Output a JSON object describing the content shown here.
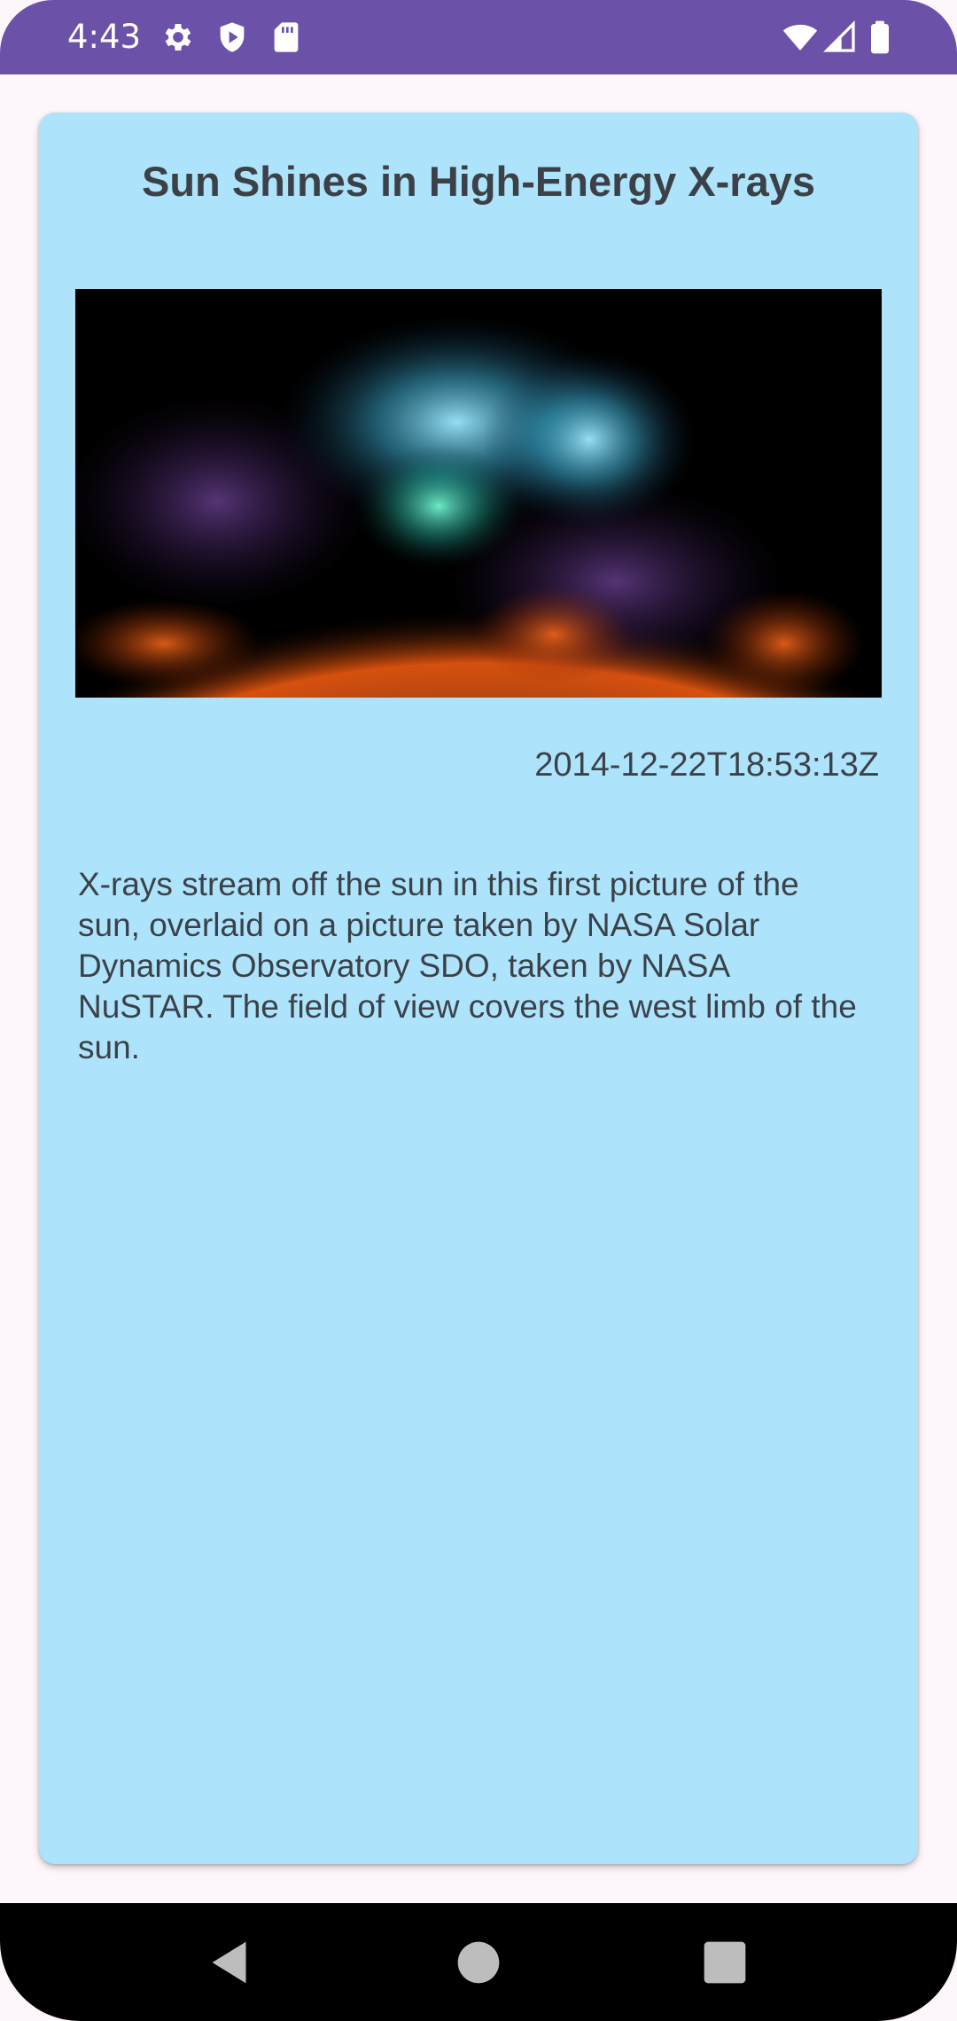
{
  "status_bar": {
    "time": "4:43",
    "left_icons": [
      "gear-icon",
      "shield-play-icon",
      "sd-card-icon"
    ],
    "right_icons": [
      "wifi-icon",
      "cell-signal-icon",
      "battery-icon"
    ],
    "color": "#6b52a8"
  },
  "card": {
    "title": "Sun Shines in High-Energy X-rays",
    "image_alt": "X-ray image of the sun",
    "date": "2014-12-22T18:53:13Z",
    "description": "X-rays stream off the sun in this first picture of the sun, overlaid on a picture taken by NASA Solar Dynamics Observatory SDO, taken by NASA NuSTAR. The field of view covers the west limb of the sun.",
    "background": "#ade4fc"
  },
  "nav_bar": {
    "buttons": [
      "back-icon",
      "home-icon",
      "recents-icon"
    ]
  }
}
